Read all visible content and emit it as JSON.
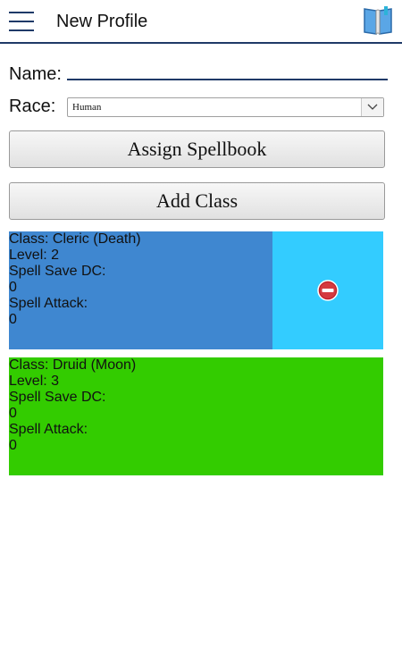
{
  "header": {
    "title": "New Profile",
    "menu_icon": "hamburger-menu-icon",
    "book_icon": "spellbook-icon"
  },
  "form": {
    "name_label": "Name:",
    "name_value": "",
    "race_label": "Race:",
    "race_selected": "Human"
  },
  "buttons": {
    "assign_spellbook": "Assign Spellbook",
    "add_class": "Add Class"
  },
  "classes": [
    {
      "class_text": "Class: Cleric (Death)",
      "level_text": "Level: 2",
      "save_dc_label": "Spell Save DC:",
      "save_dc_value": "0",
      "attack_label": "Spell Attack:",
      "attack_value": "0",
      "color": "#3f87d0",
      "action_color": "#33ccff"
    },
    {
      "class_text": "Class: Druid (Moon)",
      "level_text": "Level: 3",
      "save_dc_label": "Spell Save DC:",
      "save_dc_value": "0",
      "attack_label": "Spell Attack:",
      "attack_value": "0",
      "color": "#33cc00"
    }
  ],
  "colors": {
    "accent": "#1f3a68",
    "remove": "#c0202a"
  }
}
